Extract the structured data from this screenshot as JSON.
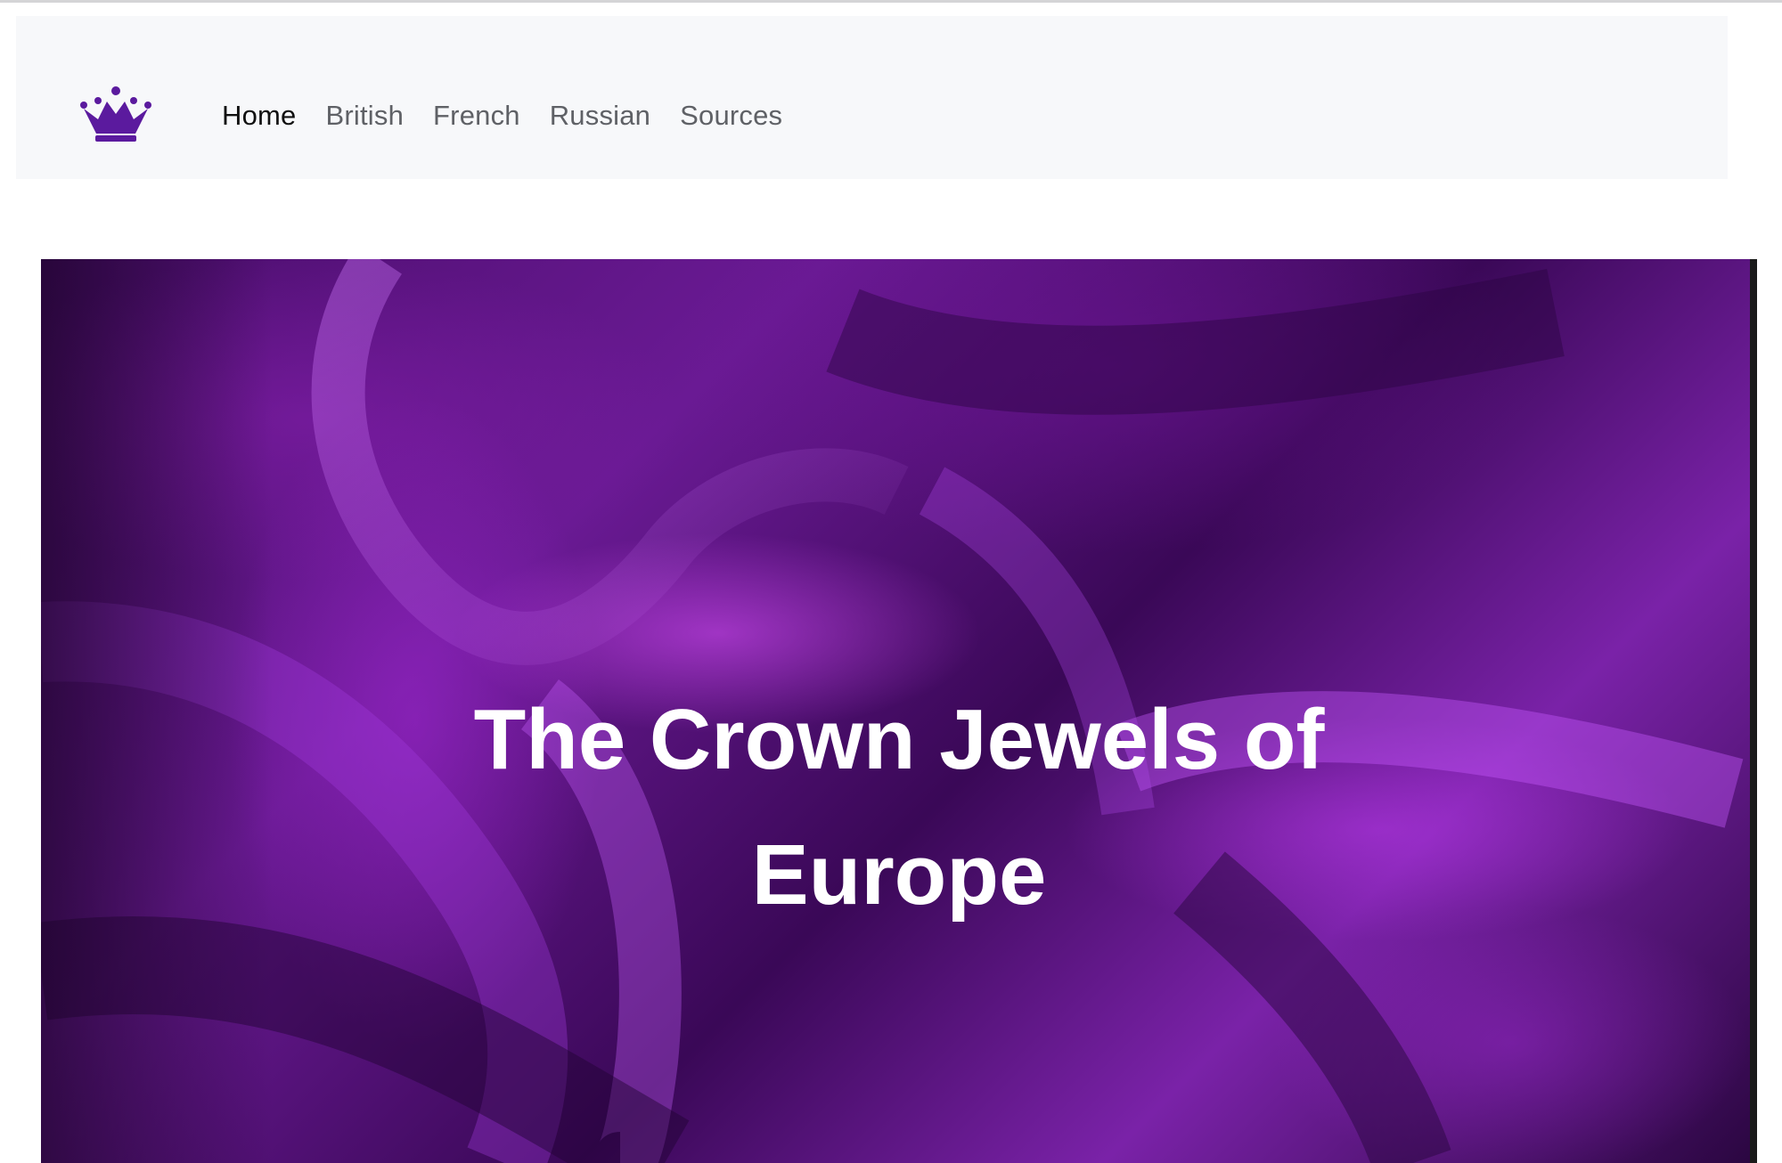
{
  "brand": {
    "logo_icon": "crown-icon",
    "accent_color": "#5b1a9e"
  },
  "nav": {
    "items": [
      {
        "label": "Home",
        "active": true
      },
      {
        "label": "British",
        "active": false
      },
      {
        "label": "French",
        "active": false
      },
      {
        "label": "Russian",
        "active": false
      },
      {
        "label": "Sources",
        "active": false
      }
    ]
  },
  "hero": {
    "title": "The Crown Jewels of Europe",
    "background": "purple-velvet-image",
    "text_color": "#ffffff"
  }
}
